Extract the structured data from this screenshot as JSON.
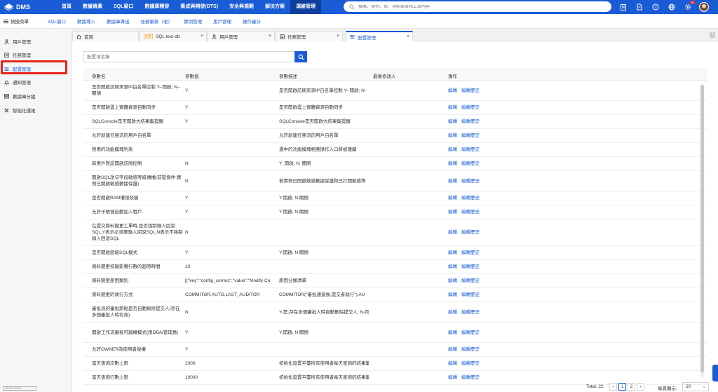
{
  "app": {
    "name": "DMS"
  },
  "nav": {
    "items": [
      "首頁",
      "數據資產",
      "SQL窗口",
      "數據庫開發",
      "集成與開發(DTS)",
      "安全與規範",
      "解決方案",
      "運維管理"
    ],
    "active_index": 7
  },
  "search": {
    "placeholder": "搜庫、實例、表、功能菜單和工單內容"
  },
  "header_icons": [
    "clipboard-icon",
    "document-icon",
    "help-icon",
    "globe-icon",
    "settings-icon",
    "avatar"
  ],
  "notification_badge": "N",
  "quickbar": {
    "menu_label": "快捷菜單",
    "links": [
      "SQL窗口",
      "數據導入",
      "數據庫導出",
      "任務編排（老）",
      "實例管理",
      "用戶管理",
      "操作審計"
    ]
  },
  "sidebar": {
    "items": [
      {
        "label": "用戶管理",
        "icon": "user-icon"
      },
      {
        "label": "任務管理",
        "icon": "task-icon"
      },
      {
        "label": "配置管理",
        "icon": "config-icon"
      },
      {
        "label": "通知管理",
        "icon": "bell-icon"
      },
      {
        "label": "數據庫分組",
        "icon": "database-group-icon"
      },
      {
        "label": "智能化運維",
        "icon": "tools-icon"
      }
    ],
    "active_index": 2,
    "footer": "10.23.240.20"
  },
  "tabs": [
    {
      "label": "首頁",
      "icon": "home-icon",
      "closable": false
    },
    {
      "label": "SQL test-db",
      "env": "生產",
      "closable": true
    },
    {
      "label": "用戶管理",
      "icon": "user-icon",
      "closable": true
    },
    {
      "label": "任務管理",
      "icon": "task-icon",
      "closable": true
    },
    {
      "label": "配置管理",
      "icon": "config-icon",
      "closable": true
    }
  ],
  "active_tab": 4,
  "param_search": {
    "placeholder": "配置項名稱"
  },
  "table": {
    "headers": [
      "參數名",
      "參數值",
      "參數描述",
      "最後修改人",
      "操作"
    ],
    "action_edit": "編輯",
    "action_history": "編輯歷史",
    "rows": [
      {
        "name": "是否開啟訪問來源IP白名單控制 Y--開啟; N--關閉",
        "value": "Y",
        "desc": "是否開啟訪問來源IP白名單控制 Y--開啟; N-",
        "lines": 2
      },
      {
        "name": "是否開啟雲上實體資源自動同步",
        "value": "Y",
        "desc": "是否開啟雲上實體資源自動同步",
        "lines": 1
      },
      {
        "name": "SQLConsole是否開啟大結果集提醒",
        "value": "Y",
        "desc": "SQLConsole是否開啟大結果集提醒",
        "lines": 1
      },
      {
        "name": "允許創建任務流的用戶白名單",
        "value": "",
        "desc": "允許創建任務流的用戶白名單",
        "lines": 1
      },
      {
        "name": "禁用的功能模塊列表",
        "value": "",
        "desc": "選中的功能模塊相應操作入口將被隱藏",
        "lines": 1
      },
      {
        "name": "新用戶默認開啟訪問控制",
        "value": "N",
        "desc": "Y: 開啟, N: 關閉",
        "lines": 1
      },
      {
        "name": "開啟SQL語句字段敏感等級傳播(前提條件:實例已開啟敏感數據保護)",
        "value": "N",
        "desc": "若實例已開啟敏感數據保護和已打開敏感等",
        "lines": 2
      },
      {
        "name": "是否開啟RAM權限校驗",
        "value": "Y",
        "desc": "Y:開啟, N:關閉",
        "lines": 1
      },
      {
        "name": "允許子帳號自動加入租戶",
        "value": "Y",
        "desc": "Y:開啟, N:關閉",
        "lines": 1
      },
      {
        "name": "在提交資料變更工單時,是否強制錄入回滾SQL,Y表示必須要錄入回滾SQL,N表示不強制錄入回滾SQL",
        "value": "N",
        "desc": "",
        "lines": 3
      },
      {
        "name": "是否開啟超級SQL模式",
        "value": "Y",
        "desc": "Y:開啟, N:關閉",
        "lines": 1
      },
      {
        "name": "資料變更校驗影響行數的超時時間",
        "value": "10",
        "desc": "",
        "lines": 1
      },
      {
        "name": "資料變更原因類別",
        "value": "[{\"key\":\"config_correct\",\"value\":\"Modify Co",
        "desc": "原因分類清單",
        "lines": 1
      },
      {
        "name": "資料變更的執行方式",
        "value": "COMMITOR,AUTO,LAST_AUDITOR",
        "desc": "COMMITOR(\"審批通過後,提交者執行\"),AU",
        "lines": 1
      },
      {
        "name": "審批流的審批節點是否自動刪除提交人(存在多個審批人時有效)",
        "value": "N",
        "desc": "Y-是,存在多個審批人時自動刪除提交人; N-否",
        "lines": 2
      },
      {
        "name": "開啟工作流審批可越權模式(限DBA/管理員)",
        "value": "Y",
        "desc": "Y:開啟, N:關閉",
        "lines": 2
      },
      {
        "name": "允許OWNER為使用者授權",
        "value": "Y",
        "desc": "",
        "lines": 1
      },
      {
        "name": "當天查詢次數上限",
        "value": "2000",
        "desc": "初始化設置平臺所有使用者每天查詢的結果集",
        "lines": 1
      },
      {
        "name": "當天查詢行數上限",
        "value": "10000",
        "desc": "初始化設置平臺所有使用者每天查詢的結果集",
        "lines": 1
      }
    ]
  },
  "pagination": {
    "total_label": "Total: 22",
    "pages": [
      "1",
      "2"
    ],
    "current_page": "1",
    "per_page_label": "每頁顯示:",
    "per_page_value": "20"
  }
}
